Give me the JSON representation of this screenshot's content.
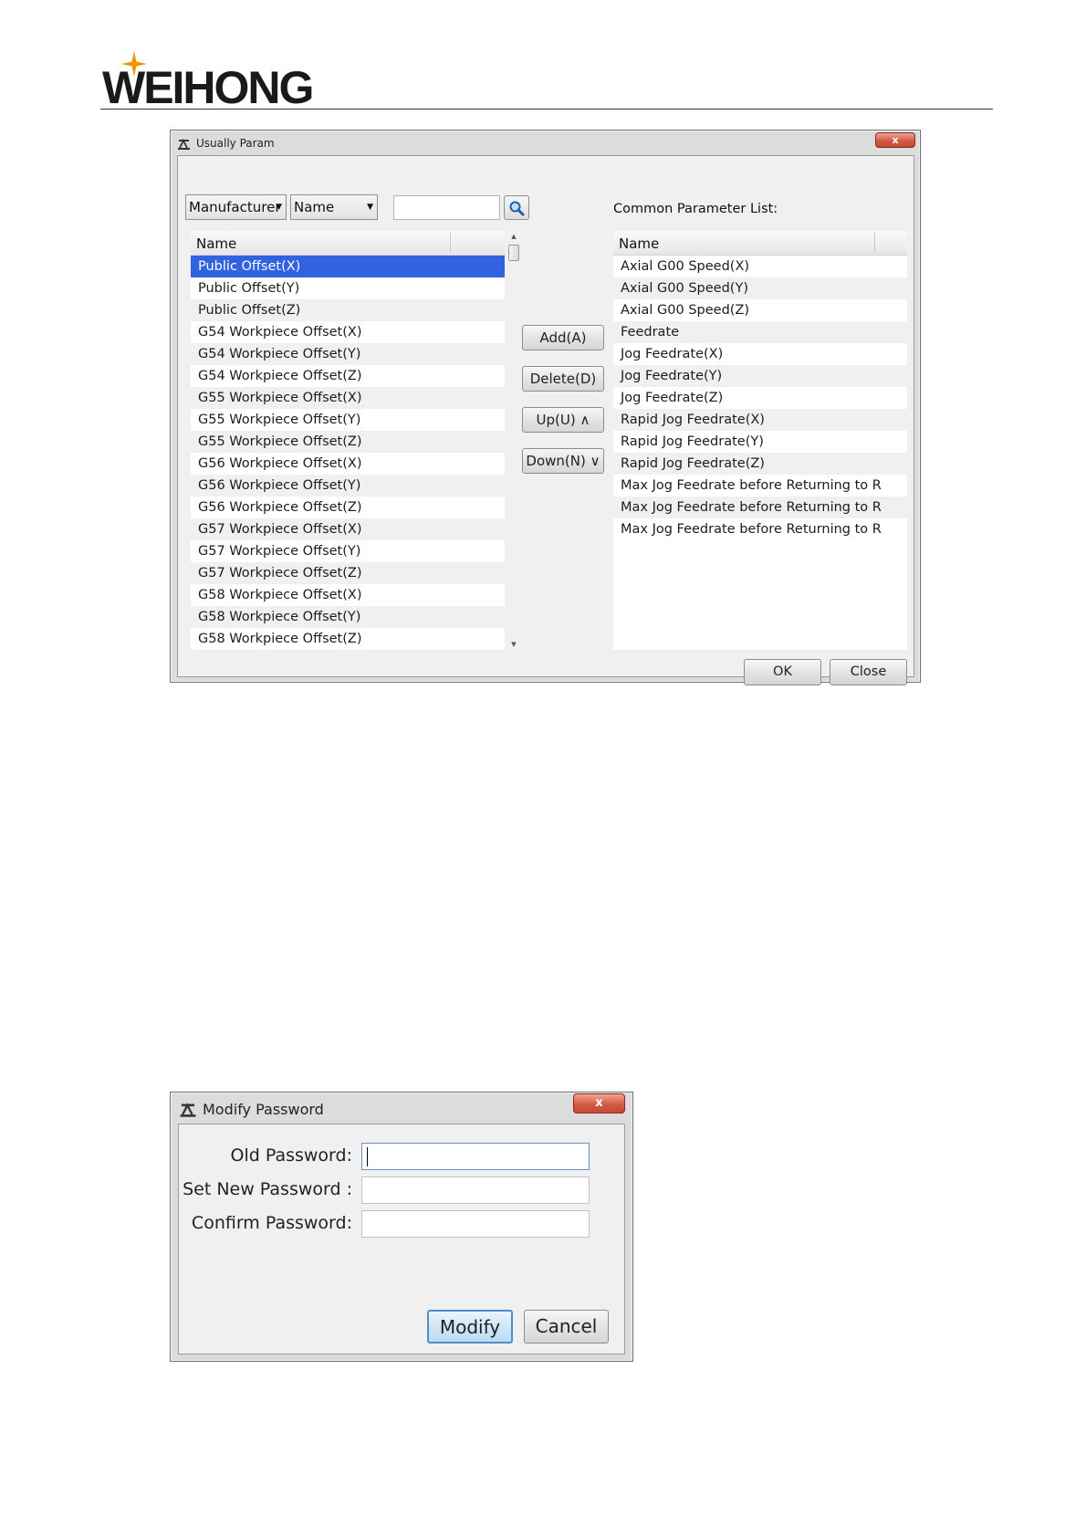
{
  "header": {
    "logo_text": "WEIHONG",
    "brand_color": "#1a1a1a",
    "star_color": "#f29400"
  },
  "usually_param": {
    "title": "Usually Param",
    "close_glyph": "x",
    "filter_combo_1": "Manufacturer",
    "filter_combo_2": "Name",
    "search_value": "",
    "search_icon": "magnifier-icon",
    "left_list": {
      "header": "Name",
      "rows": [
        "Public Offset(X)",
        "Public Offset(Y)",
        "Public Offset(Z)",
        "G54 Workpiece Offset(X)",
        "G54 Workpiece Offset(Y)",
        "G54 Workpiece Offset(Z)",
        "G55 Workpiece Offset(X)",
        "G55 Workpiece Offset(Y)",
        "G55 Workpiece Offset(Z)",
        "G56 Workpiece Offset(X)",
        "G56 Workpiece Offset(Y)",
        "G56 Workpiece Offset(Z)",
        "G57 Workpiece Offset(X)",
        "G57 Workpiece Offset(Y)",
        "G57 Workpiece Offset(Z)",
        "G58 Workpiece Offset(X)",
        "G58 Workpiece Offset(Y)",
        "G58 Workpiece Offset(Z)"
      ],
      "selected_index": 0
    },
    "buttons": {
      "add": "Add(A)",
      "delete": "Delete(D)",
      "up": "Up(U) ∧",
      "down": "Down(N) ∨",
      "ok": "OK",
      "close": "Close"
    },
    "common_label": "Common Parameter List:",
    "right_list": {
      "header": "Name",
      "rows": [
        "Axial G00 Speed(X)",
        "Axial G00 Speed(Y)",
        "Axial G00 Speed(Z)",
        "Feedrate",
        "Jog Feedrate(X)",
        "Jog Feedrate(Y)",
        "Jog Feedrate(Z)",
        "Rapid Jog Feedrate(X)",
        "Rapid Jog Feedrate(Y)",
        "Rapid Jog Feedrate(Z)",
        "Max Jog Feedrate before Returning to R",
        "Max Jog Feedrate before Returning to R",
        "Max Jog Feedrate before Returning to R"
      ]
    },
    "selection_color": "#3162e0"
  },
  "modify_password": {
    "title": "Modify Password",
    "close_glyph": "x",
    "labels": {
      "old": "Old Password:",
      "new": "Set New Password :",
      "confirm": "Confirm Password:"
    },
    "values": {
      "old": "",
      "new": "",
      "confirm": ""
    },
    "buttons": {
      "modify": "Modify",
      "cancel": "Cancel"
    },
    "default_button_color": "#4f8fc8"
  }
}
